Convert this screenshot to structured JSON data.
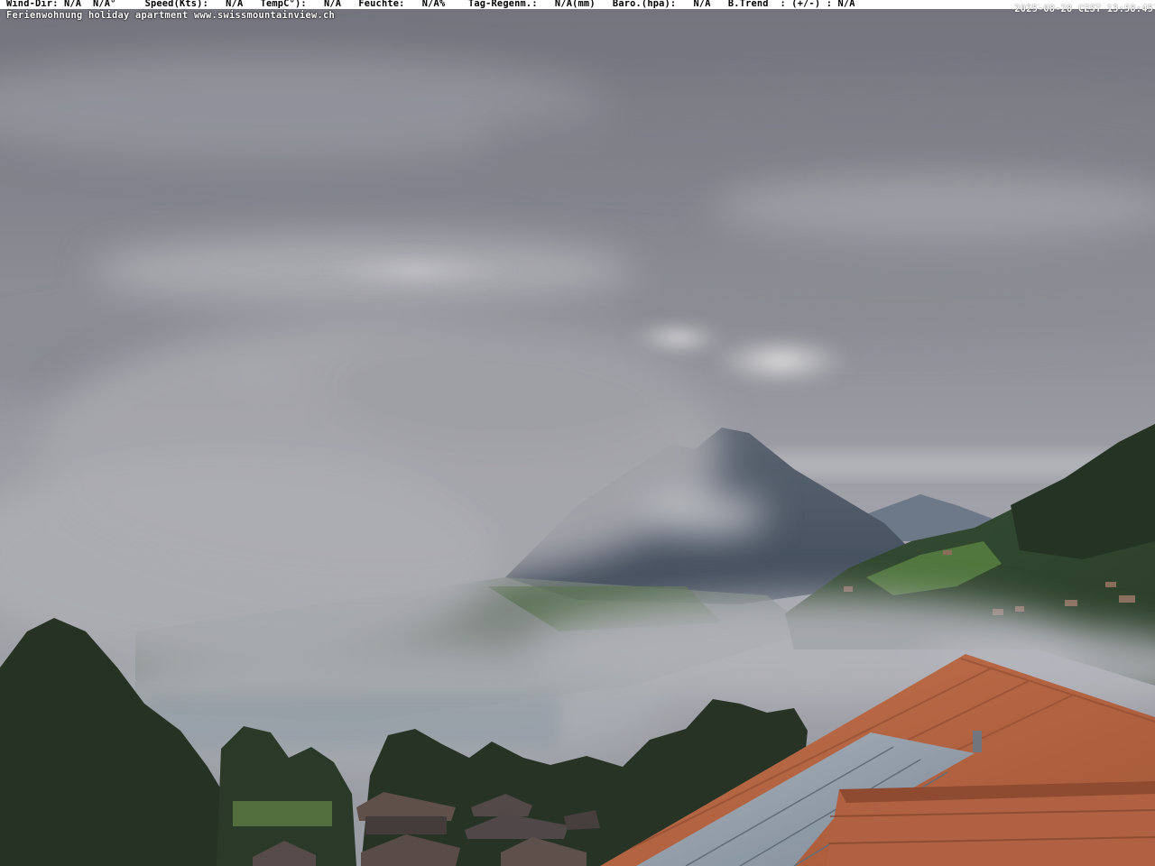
{
  "overlay": {
    "weather_line": "Wind-Dir: N/A  N/A°     Speed(Kts):   N/A   TempC°):   N/A   Feuchte:   N/A%    Tag-Regenm.:   N/A(mm)   Baro.(hpa):   N/A   B.Trend  : (+/-) : N/A",
    "timestamp": "2025-08-28 CEST 13:58:45",
    "caption": "Ferienwohnung holiday apartment www.swissmountainview.ch"
  },
  "colors": {
    "overlay_bar": "#ffffff",
    "sky": "#8e8f96",
    "mountain": "#3f4a5a",
    "forest": "#1f2b1c",
    "roof_tiles": "#b5603c",
    "solar_panel": "#8d9aa8"
  }
}
